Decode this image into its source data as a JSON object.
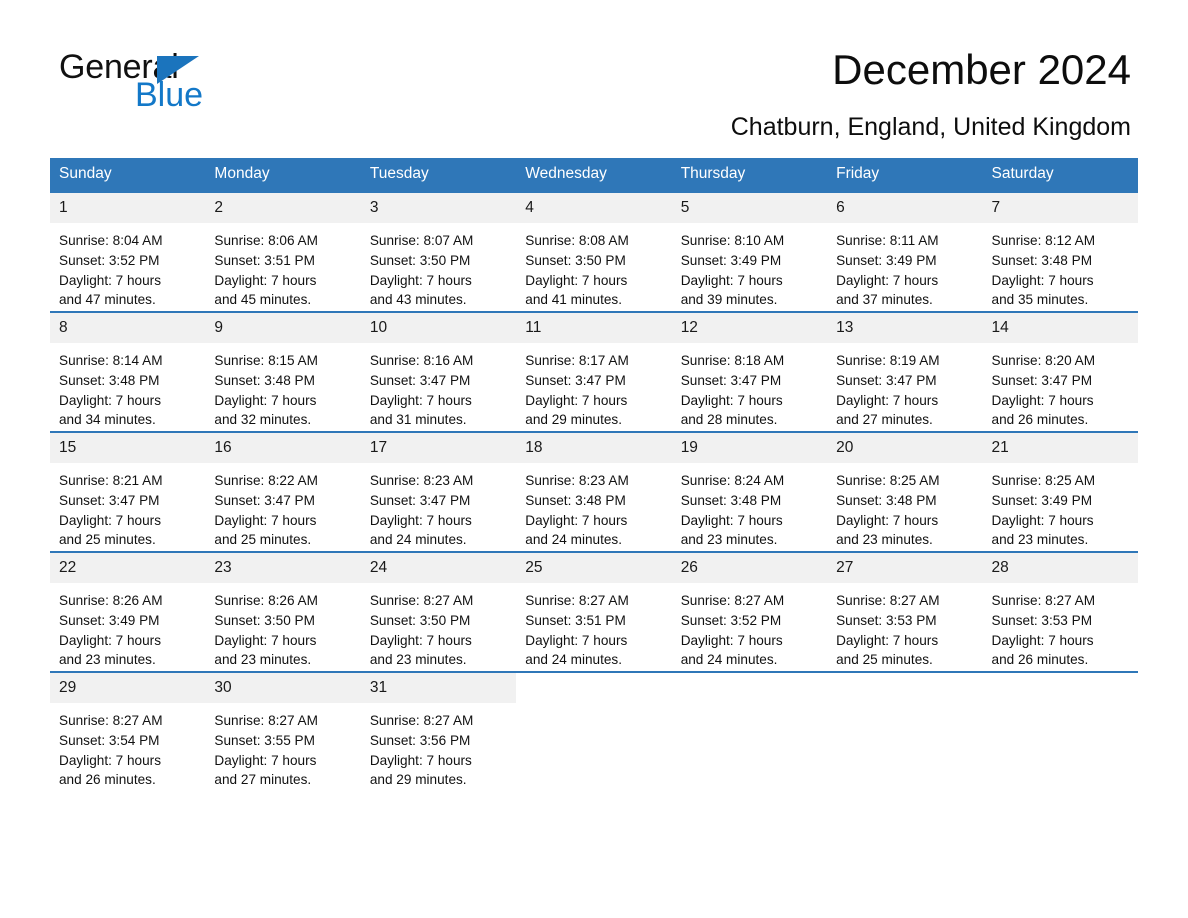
{
  "brand": {
    "line1": "General",
    "line2": "Blue",
    "triangle_color": "#1b74bd"
  },
  "header": {
    "title": "December 2024",
    "location": "Chatburn, England, United Kingdom"
  },
  "theme": {
    "header_blue": "#2f77b8",
    "daynum_gray": "#f1f1f1",
    "text_black": "#111111"
  },
  "weekdays": [
    "Sunday",
    "Monday",
    "Tuesday",
    "Wednesday",
    "Thursday",
    "Friday",
    "Saturday"
  ],
  "weeks": [
    [
      {
        "day": "1",
        "sunrise": "Sunrise: 8:04 AM",
        "sunset": "Sunset: 3:52 PM",
        "daylight1": "Daylight: 7 hours",
        "daylight2": "and 47 minutes."
      },
      {
        "day": "2",
        "sunrise": "Sunrise: 8:06 AM",
        "sunset": "Sunset: 3:51 PM",
        "daylight1": "Daylight: 7 hours",
        "daylight2": "and 45 minutes."
      },
      {
        "day": "3",
        "sunrise": "Sunrise: 8:07 AM",
        "sunset": "Sunset: 3:50 PM",
        "daylight1": "Daylight: 7 hours",
        "daylight2": "and 43 minutes."
      },
      {
        "day": "4",
        "sunrise": "Sunrise: 8:08 AM",
        "sunset": "Sunset: 3:50 PM",
        "daylight1": "Daylight: 7 hours",
        "daylight2": "and 41 minutes."
      },
      {
        "day": "5",
        "sunrise": "Sunrise: 8:10 AM",
        "sunset": "Sunset: 3:49 PM",
        "daylight1": "Daylight: 7 hours",
        "daylight2": "and 39 minutes."
      },
      {
        "day": "6",
        "sunrise": "Sunrise: 8:11 AM",
        "sunset": "Sunset: 3:49 PM",
        "daylight1": "Daylight: 7 hours",
        "daylight2": "and 37 minutes."
      },
      {
        "day": "7",
        "sunrise": "Sunrise: 8:12 AM",
        "sunset": "Sunset: 3:48 PM",
        "daylight1": "Daylight: 7 hours",
        "daylight2": "and 35 minutes."
      }
    ],
    [
      {
        "day": "8",
        "sunrise": "Sunrise: 8:14 AM",
        "sunset": "Sunset: 3:48 PM",
        "daylight1": "Daylight: 7 hours",
        "daylight2": "and 34 minutes."
      },
      {
        "day": "9",
        "sunrise": "Sunrise: 8:15 AM",
        "sunset": "Sunset: 3:48 PM",
        "daylight1": "Daylight: 7 hours",
        "daylight2": "and 32 minutes."
      },
      {
        "day": "10",
        "sunrise": "Sunrise: 8:16 AM",
        "sunset": "Sunset: 3:47 PM",
        "daylight1": "Daylight: 7 hours",
        "daylight2": "and 31 minutes."
      },
      {
        "day": "11",
        "sunrise": "Sunrise: 8:17 AM",
        "sunset": "Sunset: 3:47 PM",
        "daylight1": "Daylight: 7 hours",
        "daylight2": "and 29 minutes."
      },
      {
        "day": "12",
        "sunrise": "Sunrise: 8:18 AM",
        "sunset": "Sunset: 3:47 PM",
        "daylight1": "Daylight: 7 hours",
        "daylight2": "and 28 minutes."
      },
      {
        "day": "13",
        "sunrise": "Sunrise: 8:19 AM",
        "sunset": "Sunset: 3:47 PM",
        "daylight1": "Daylight: 7 hours",
        "daylight2": "and 27 minutes."
      },
      {
        "day": "14",
        "sunrise": "Sunrise: 8:20 AM",
        "sunset": "Sunset: 3:47 PM",
        "daylight1": "Daylight: 7 hours",
        "daylight2": "and 26 minutes."
      }
    ],
    [
      {
        "day": "15",
        "sunrise": "Sunrise: 8:21 AM",
        "sunset": "Sunset: 3:47 PM",
        "daylight1": "Daylight: 7 hours",
        "daylight2": "and 25 minutes."
      },
      {
        "day": "16",
        "sunrise": "Sunrise: 8:22 AM",
        "sunset": "Sunset: 3:47 PM",
        "daylight1": "Daylight: 7 hours",
        "daylight2": "and 25 minutes."
      },
      {
        "day": "17",
        "sunrise": "Sunrise: 8:23 AM",
        "sunset": "Sunset: 3:47 PM",
        "daylight1": "Daylight: 7 hours",
        "daylight2": "and 24 minutes."
      },
      {
        "day": "18",
        "sunrise": "Sunrise: 8:23 AM",
        "sunset": "Sunset: 3:48 PM",
        "daylight1": "Daylight: 7 hours",
        "daylight2": "and 24 minutes."
      },
      {
        "day": "19",
        "sunrise": "Sunrise: 8:24 AM",
        "sunset": "Sunset: 3:48 PM",
        "daylight1": "Daylight: 7 hours",
        "daylight2": "and 23 minutes."
      },
      {
        "day": "20",
        "sunrise": "Sunrise: 8:25 AM",
        "sunset": "Sunset: 3:48 PM",
        "daylight1": "Daylight: 7 hours",
        "daylight2": "and 23 minutes."
      },
      {
        "day": "21",
        "sunrise": "Sunrise: 8:25 AM",
        "sunset": "Sunset: 3:49 PM",
        "daylight1": "Daylight: 7 hours",
        "daylight2": "and 23 minutes."
      }
    ],
    [
      {
        "day": "22",
        "sunrise": "Sunrise: 8:26 AM",
        "sunset": "Sunset: 3:49 PM",
        "daylight1": "Daylight: 7 hours",
        "daylight2": "and 23 minutes."
      },
      {
        "day": "23",
        "sunrise": "Sunrise: 8:26 AM",
        "sunset": "Sunset: 3:50 PM",
        "daylight1": "Daylight: 7 hours",
        "daylight2": "and 23 minutes."
      },
      {
        "day": "24",
        "sunrise": "Sunrise: 8:27 AM",
        "sunset": "Sunset: 3:50 PM",
        "daylight1": "Daylight: 7 hours",
        "daylight2": "and 23 minutes."
      },
      {
        "day": "25",
        "sunrise": "Sunrise: 8:27 AM",
        "sunset": "Sunset: 3:51 PM",
        "daylight1": "Daylight: 7 hours",
        "daylight2": "and 24 minutes."
      },
      {
        "day": "26",
        "sunrise": "Sunrise: 8:27 AM",
        "sunset": "Sunset: 3:52 PM",
        "daylight1": "Daylight: 7 hours",
        "daylight2": "and 24 minutes."
      },
      {
        "day": "27",
        "sunrise": "Sunrise: 8:27 AM",
        "sunset": "Sunset: 3:53 PM",
        "daylight1": "Daylight: 7 hours",
        "daylight2": "and 25 minutes."
      },
      {
        "day": "28",
        "sunrise": "Sunrise: 8:27 AM",
        "sunset": "Sunset: 3:53 PM",
        "daylight1": "Daylight: 7 hours",
        "daylight2": "and 26 minutes."
      }
    ],
    [
      {
        "day": "29",
        "sunrise": "Sunrise: 8:27 AM",
        "sunset": "Sunset: 3:54 PM",
        "daylight1": "Daylight: 7 hours",
        "daylight2": "and 26 minutes."
      },
      {
        "day": "30",
        "sunrise": "Sunrise: 8:27 AM",
        "sunset": "Sunset: 3:55 PM",
        "daylight1": "Daylight: 7 hours",
        "daylight2": "and 27 minutes."
      },
      {
        "day": "31",
        "sunrise": "Sunrise: 8:27 AM",
        "sunset": "Sunset: 3:56 PM",
        "daylight1": "Daylight: 7 hours",
        "daylight2": "and 29 minutes."
      },
      null,
      null,
      null,
      null
    ]
  ]
}
